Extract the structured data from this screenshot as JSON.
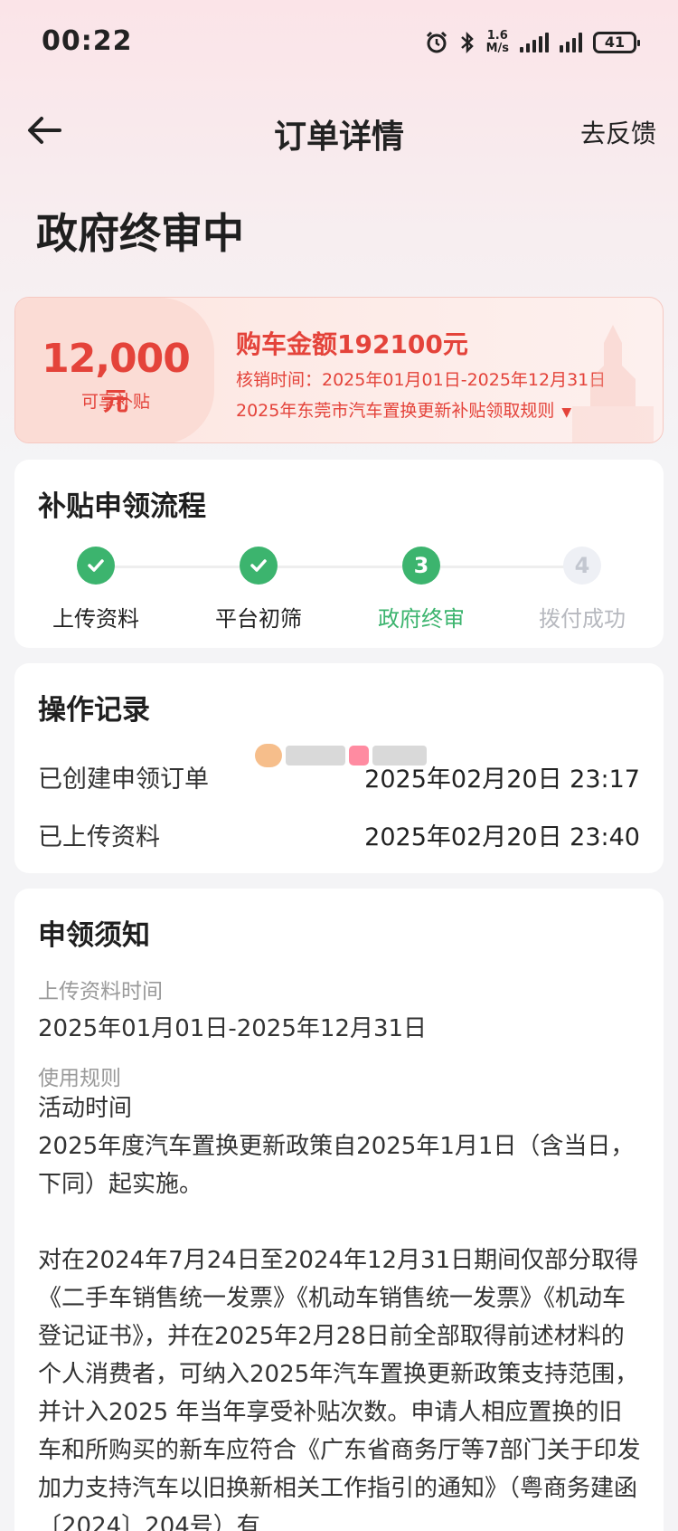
{
  "status_bar": {
    "time": "00:22",
    "net_speed_value": "1.6",
    "net_speed_unit": "M/s",
    "battery": "41",
    "icons": [
      "alarm-icon",
      "bluetooth-icon",
      "signal-icon",
      "battery-icon"
    ]
  },
  "nav": {
    "title": "订单详情",
    "feedback": "去反馈"
  },
  "page_status": "政府终审中",
  "subsidy": {
    "amount": "12,000",
    "unit": "元",
    "caption": "可享补贴",
    "purchase": "购车金额192100元",
    "verify_time": "核销时间：2025年01月01日-2025年12月31日",
    "rule_link": "2025年东莞市汽车置换更新补贴领取规则",
    "accent_color": "#e4433a"
  },
  "flow": {
    "title": "补贴申领流程",
    "steps": [
      {
        "label": "上传资料",
        "state": "done",
        "mark": ""
      },
      {
        "label": "平台初筛",
        "state": "done",
        "mark": ""
      },
      {
        "label": "政府终审",
        "state": "current",
        "mark": "3"
      },
      {
        "label": "拨付成功",
        "state": "todo",
        "mark": "4"
      }
    ],
    "success_color": "#3cb46e"
  },
  "ops": {
    "title": "操作记录",
    "rows": [
      {
        "label": "已创建申领订单",
        "time": "2025年02月20日 23:17"
      },
      {
        "label": "已上传资料",
        "time": "2025年02月20日 23:40"
      }
    ]
  },
  "notice": {
    "title": "申领须知",
    "upload_label": "上传资料时间",
    "upload_value": "2025年01月01日-2025年12月31日",
    "rule_label": "使用规则",
    "body_p1": "活动时间\n2025年度汽车置换更新政策自2025年1月1日（含当日，下同）起实施。",
    "body_p2": "对在2024年7月24日至2024年12月31日期间仅部分取得《二手车销售统一发票》《机动车销售统一发票》《机动车登记证书》，并在2025年2月28日前全部取得前述材料的个人消费者，可纳入2025年汽车置换更新政策支持范围，并计入2025 年当年享受补贴次数。申请人相应置换的旧车和所购买的新车应符合《广东省商务厅等7部门关于印发加力支持汽车以旧换新相关工作指引的通知》（粤商务建函〔2024〕204号）有"
  }
}
